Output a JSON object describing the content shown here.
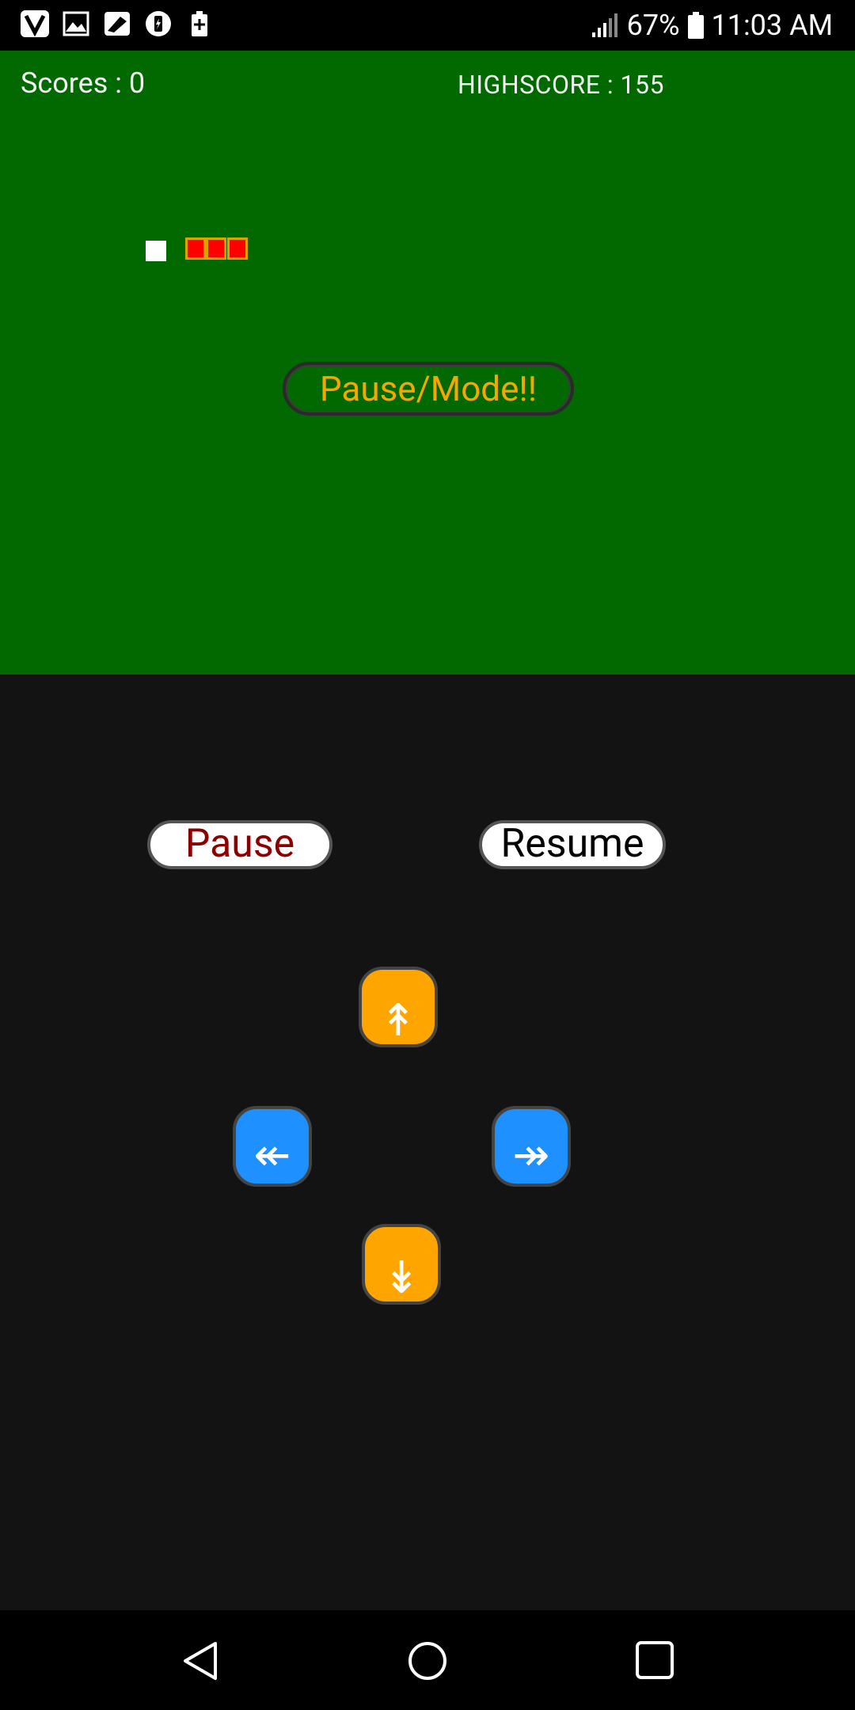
{
  "status_bar": {
    "left_icons": [
      "vlc-icon",
      "gallery-icon",
      "cleaner-icon",
      "battery-saver-icon",
      "battery-plus-icon"
    ],
    "battery_percent": "67%",
    "time": "11:03 AM"
  },
  "game": {
    "score_text": "Scores : 0",
    "highscore_text": "HIGHSCORE : 155",
    "mode_button_label": "Pause/Mode!!",
    "snake_length": 3,
    "colors": {
      "field": "#016900",
      "snake": "#ff0000",
      "food": "#ffffff"
    }
  },
  "controls": {
    "pause_label": "Pause",
    "resume_label": "Resume",
    "up_label": "↟",
    "down_label": "↡",
    "left_label": "↞",
    "right_label": "↠",
    "colors": {
      "vertical": "#ffa500",
      "horizontal": "#1e90ff"
    }
  },
  "navbar": {
    "buttons": [
      "back-icon",
      "home-icon",
      "recents-icon"
    ]
  }
}
